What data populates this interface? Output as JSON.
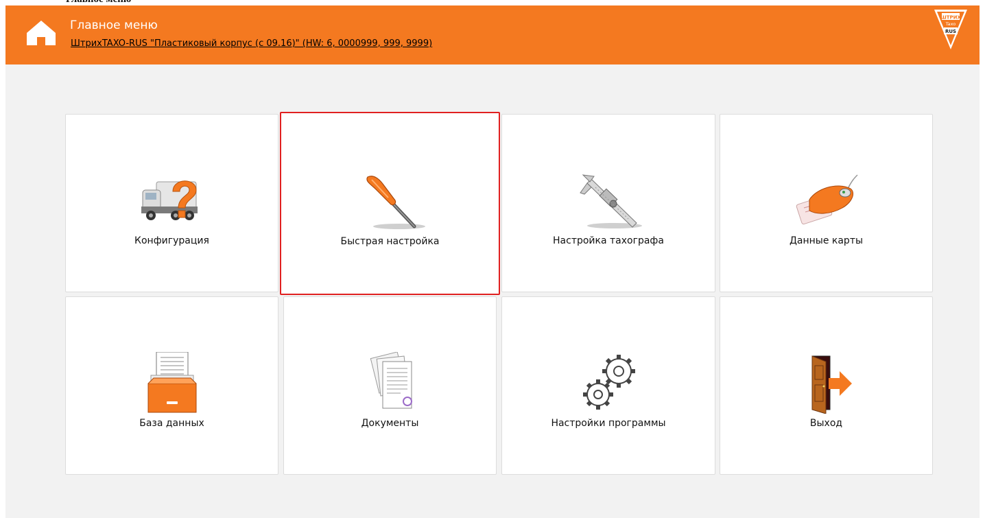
{
  "header": {
    "title": "Главное меню",
    "device_link": "ШтрихTAXO-RUS \"Пластиковый корпус (с 09.16)\" (HW: 6, 0000999, 999, 9999)",
    "accent_color": "#f47920",
    "logo": {
      "line1": "ШТРИХ",
      "line2": "Taxo",
      "line3": "RUS"
    }
  },
  "tiles": [
    {
      "label": "Конфигурация",
      "icon": "truck-question-icon"
    },
    {
      "label": "Быстрая настройка",
      "icon": "screwdriver-icon",
      "selected": true
    },
    {
      "label": "Настройка тахографа",
      "icon": "caliper-icon"
    },
    {
      "label": "Данные карты",
      "icon": "card-reader-icon"
    },
    {
      "label": "База данных",
      "icon": "card-file-drawer-icon"
    },
    {
      "label": "Документы",
      "icon": "documents-icon"
    },
    {
      "label": "Настройки программы",
      "icon": "gears-icon"
    },
    {
      "label": "Выход",
      "icon": "exit-door-icon"
    }
  ],
  "selection_color": "#e02020"
}
